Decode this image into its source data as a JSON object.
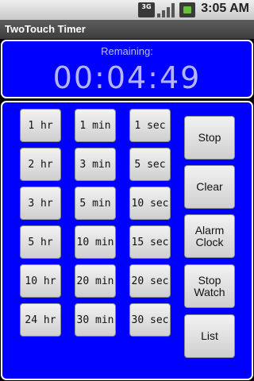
{
  "status_bar": {
    "network_badge": "3G",
    "icons": [
      "signal-icon",
      "battery-icon"
    ],
    "time": "3:05 AM"
  },
  "app": {
    "title": "TwoTouch Timer"
  },
  "timer": {
    "label": "Remaining:",
    "display": "00:04:49"
  },
  "time_buttons": {
    "hours": [
      "1 hr",
      "2 hr",
      "3 hr",
      "5 hr",
      "10 hr",
      "24 hr"
    ],
    "minutes": [
      "1 min",
      "3 min",
      "5 min",
      "10 min",
      "20 min",
      "30 min"
    ],
    "seconds": [
      "1 sec",
      "5 sec",
      "10 sec",
      "15 sec",
      "20 sec",
      "30 sec"
    ]
  },
  "actions": {
    "stop": "Stop",
    "clear": "Clear",
    "alarm_clock": "Alarm Clock",
    "stop_watch": "Stop Watch",
    "list": "List"
  },
  "colors": {
    "panel_background": "#0000ff",
    "title_bar": "#4a4a4a"
  }
}
